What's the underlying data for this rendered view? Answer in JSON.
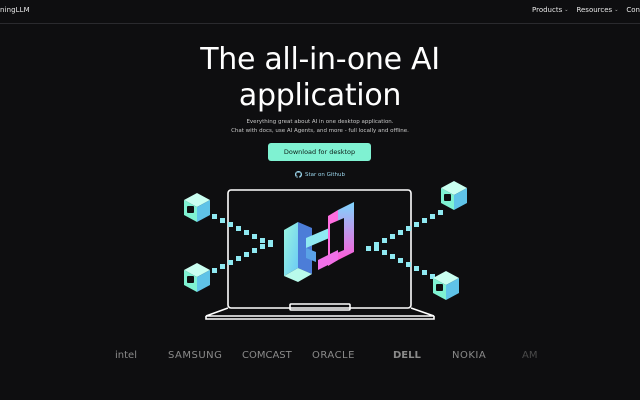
{
  "nav": {
    "brand": "ningLLM",
    "items": [
      {
        "label": "Products"
      },
      {
        "label": "Resources"
      },
      {
        "label": "Con"
      }
    ]
  },
  "hero": {
    "title_line1": "The all-in-one AI",
    "title_line2": "application",
    "subtitle_line1": "Everything great about AI in one desktop application.",
    "subtitle_line2": "Chat with docs, use AI Agents, and more - full locally and offline.",
    "cta_label": "Download for desktop",
    "star_label": "Star on Github"
  },
  "logos": [
    "intel",
    "SAMSUNG",
    "COMCAST",
    "ORACLE",
    "DELL",
    "NOKIA",
    "AM"
  ],
  "colors": {
    "accent": "#7ff2d2",
    "background": "#0e0e10",
    "star_link": "#9ed9f0"
  }
}
